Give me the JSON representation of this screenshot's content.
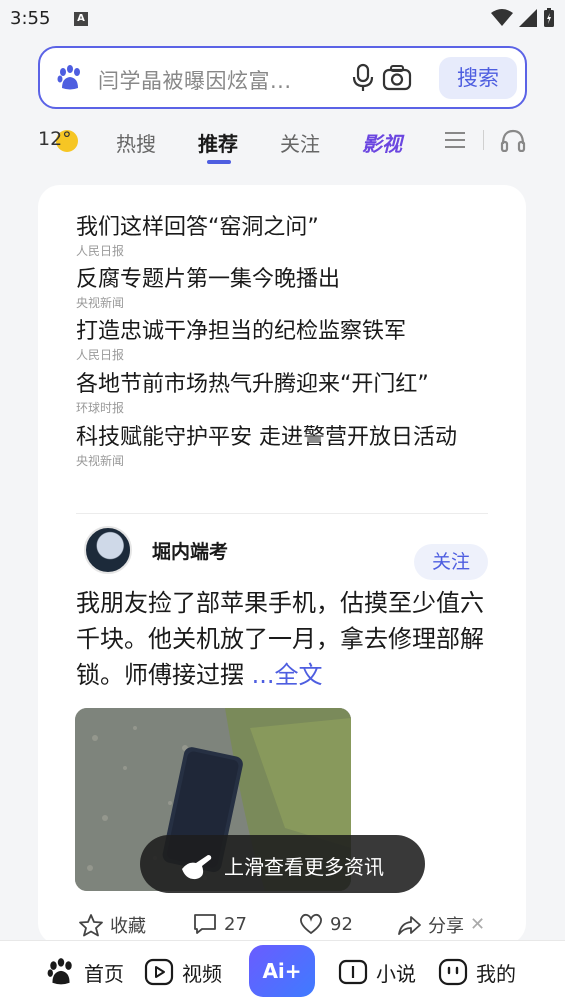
{
  "status_bar": {
    "time": "3:55",
    "notification_letter": "A"
  },
  "search": {
    "placeholder": "闫学晶被曝因炫富...",
    "button_label": "搜索"
  },
  "tabs": {
    "weather_temp": "12°",
    "items": [
      "热搜",
      "推荐",
      "关注",
      "影视"
    ]
  },
  "news": [
    {
      "title": "我们这样回答“窑洞之问”",
      "source": "人民日报"
    },
    {
      "title": "反腐专题片第一集今晚播出",
      "source": "央视新闻"
    },
    {
      "title": "打造忠诚干净担当的纪检监察铁军",
      "source": "人民日报"
    },
    {
      "title": "各地节前市场热气升腾迎来“开门红”",
      "source": "环球时报"
    },
    {
      "title": "科技赋能守护平安 走进警营开放日活动",
      "source": "央视新闻"
    }
  ],
  "post": {
    "author": "堀内端考",
    "follow_label": "关注",
    "text": "我朋友捡了部苹果手机，估摸至少值六千块。他关机放了一月，拿去修理部解锁。师傅接过摆",
    "more_label": "...全文"
  },
  "toast": {
    "text": "上滑查看更多资讯"
  },
  "actions": {
    "favorite": "收藏",
    "comments": "27",
    "likes": "92",
    "share": "分享"
  },
  "bottom_nav": {
    "home": "首页",
    "video": "视频",
    "ai": "Ai+",
    "novel": "小说",
    "mine": "我的"
  }
}
